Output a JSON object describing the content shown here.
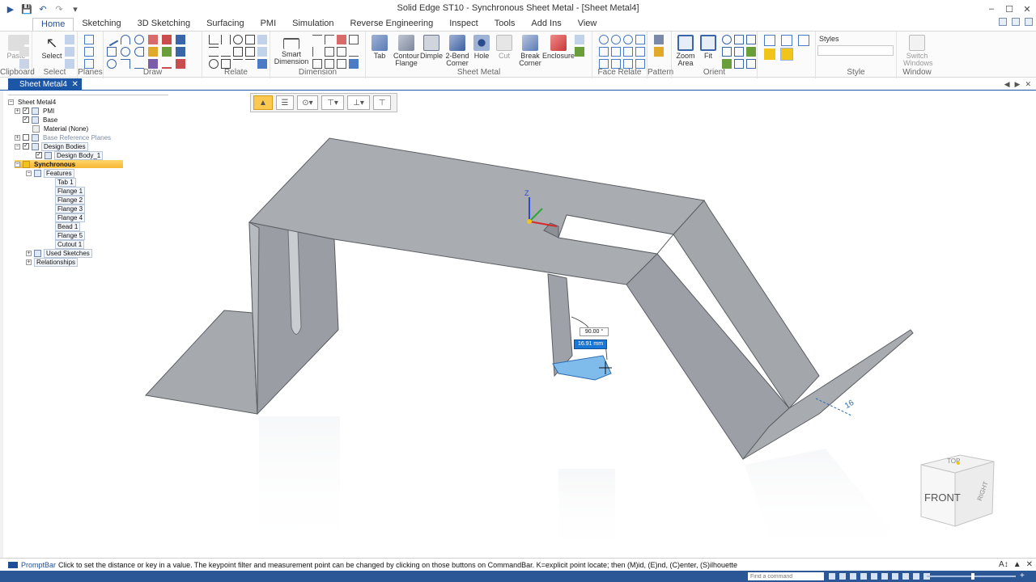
{
  "window": {
    "title": "Solid Edge ST10 - Synchronous Sheet Metal - [Sheet Metal4]"
  },
  "ribbon_tabs": [
    "Home",
    "Sketching",
    "3D Sketching",
    "Surfacing",
    "PMI",
    "Simulation",
    "Reverse Engineering",
    "Inspect",
    "Tools",
    "Add Ins",
    "View"
  ],
  "ribbon": {
    "groups": {
      "clipboard": "Clipboard",
      "select": "Select",
      "planes": "Planes",
      "draw": "Draw",
      "relate": "Relate",
      "dimension": "Dimension",
      "sheet_metal": "Sheet Metal",
      "face_relate": "Face Relate",
      "pattern": "Pattern",
      "orient": "Orient",
      "style": "Style",
      "window": "Window"
    },
    "buttons": {
      "paste": "Paste",
      "select": "Select",
      "smart_dimension": "Smart Dimension",
      "tab": "Tab",
      "contour_flange": "Contour Flange",
      "dimple": "Dimple",
      "two_bend_corner": "2-Bend Corner",
      "hole": "Hole",
      "cut": "Cut",
      "break_corner": "Break Corner",
      "enclosure": "Enclosure",
      "zoom_area": "Zoom Area",
      "fit": "Fit",
      "styles": "Styles",
      "switch_windows": "Switch Windows"
    }
  },
  "document_tab": "Sheet Metal4",
  "tree": {
    "root": "Sheet Metal4",
    "pmi": "PMI",
    "base": "Base",
    "material": "Material (None)",
    "base_reference_planes": "Base Reference Planes",
    "design_bodies": "Design Bodies",
    "design_body": "Design Body_1",
    "synchronous": "Synchronous",
    "features": "Features",
    "items": [
      "Tab 1",
      "Flange 1",
      "Flange 2",
      "Flange 3",
      "Flange 4",
      "Bead 1",
      "Flange 5",
      "Cutout 1"
    ],
    "used_sketches": "Used Sketches",
    "relationships": "Relationships"
  },
  "viewport": {
    "angle_value": "90.00 °",
    "distance_value": "16.91 mm",
    "edge_label": "16",
    "triad_z_label": "Z"
  },
  "view_cube": {
    "top": "TOP",
    "front": "FRONT",
    "right": "RIGHT"
  },
  "prompt_bar": {
    "label": "PromptBar",
    "text": "Click to set the distance or key in a value. The keypoint filter and measurement point can be changed by clicking on those buttons on CommandBar.  K=explicit point locate; then (M)id, (E)nd, (C)enter, (S)ilhouette"
  },
  "status_bar": {
    "find_placeholder": "Find a command"
  },
  "colors": {
    "accent": "#1c56a6",
    "status_bar": "#2b5797",
    "selected_node": "#f7b733",
    "model_face": "#a9acb1",
    "highlight_face": "#7fbcec"
  }
}
